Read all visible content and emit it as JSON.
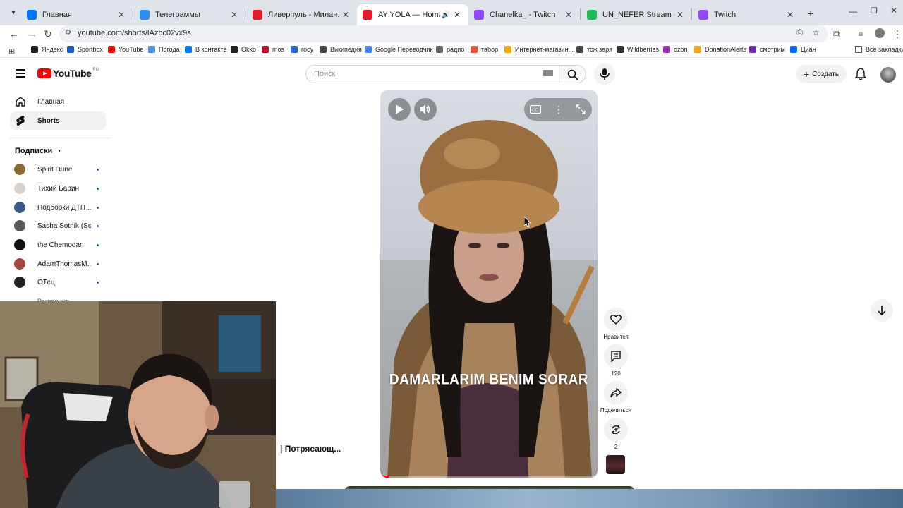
{
  "browser": {
    "tabs": [
      {
        "title": "Главная",
        "color": "#0077ff",
        "active": false
      },
      {
        "title": "Телеграммы",
        "color": "#2b8ff0",
        "active": false
      },
      {
        "title": "Ливерпуль - Милан. Повтор",
        "color": "#e01a2b",
        "active": false
      },
      {
        "title": "AY YOLA — Homay (Türkçe)",
        "color": "#e01a2b",
        "active": true
      },
      {
        "title": "Chanelka_ - Twitch",
        "color": "#9146ff",
        "active": false
      },
      {
        "title": "UN_NEFER Stream - Watch Live",
        "color": "#1db954",
        "active": false
      },
      {
        "title": "Twitch",
        "color": "#9146ff",
        "active": false
      }
    ],
    "url": "youtube.com/shorts/lAzbc02vx9s",
    "bookmarks": [
      {
        "label": "Яндекс",
        "color": "#222"
      },
      {
        "label": "Sportbox",
        "color": "#1c5dbf"
      },
      {
        "label": "YouTube",
        "color": "#ff0000"
      },
      {
        "label": "Погода",
        "color": "#4a8fd8"
      },
      {
        "label": "В контакте",
        "color": "#0077ff"
      },
      {
        "label": "Okko",
        "color": "#222"
      },
      {
        "label": "mos",
        "color": "#c4142d"
      },
      {
        "label": "госу",
        "color": "#2f67c9"
      },
      {
        "label": "Википедия",
        "color": "#444"
      },
      {
        "label": "Google Переводчик",
        "color": "#4285f4"
      },
      {
        "label": "радио",
        "color": "#666"
      },
      {
        "label": "табор",
        "color": "#e8563f"
      },
      {
        "label": "Интернет-магазин...",
        "color": "#f0a500"
      },
      {
        "label": "тсж заря",
        "color": "#444"
      },
      {
        "label": "Wildberries",
        "color": "#333"
      },
      {
        "label": "ozon",
        "color": "#9b2fae"
      },
      {
        "label": "DonationAlerts",
        "color": "#f5a623"
      },
      {
        "label": "смотрим",
        "color": "#6c2aa8"
      },
      {
        "label": "Циан",
        "color": "#0468ff"
      }
    ],
    "all_bookmarks": "Все закладки"
  },
  "youtube": {
    "logo": "YouTube",
    "region": "RU",
    "search_placeholder": "Поиск",
    "create_label": "Создать",
    "sidebar": {
      "home": "Главная",
      "shorts": "Shorts",
      "subscriptions_title": "Подписки",
      "subscriptions": [
        {
          "name": "Spirit Dune",
          "color": "#8a6a2e"
        },
        {
          "name": "Тихий Барин",
          "color": "#d9d2cc"
        },
        {
          "name": "Подборки ДТП ...",
          "color": "#3a5a8a"
        },
        {
          "name": "Sasha Sotnik (So...",
          "color": "#5a5a5a"
        },
        {
          "name": "the Chemodan",
          "color": "#111111"
        },
        {
          "name": "AdamThomasM...",
          "color": "#a04a3a"
        },
        {
          "name": "ОТец",
          "color": "#222222"
        }
      ],
      "more": "Развернуть"
    },
    "video": {
      "caption": "DAMARLARIM BENIM SORAR",
      "title_partial": "| Потрясающ..."
    },
    "actions": {
      "like_label": "Нравится",
      "comments_count": "120",
      "share_label": "Поделиться",
      "remix_count": "2"
    }
  }
}
